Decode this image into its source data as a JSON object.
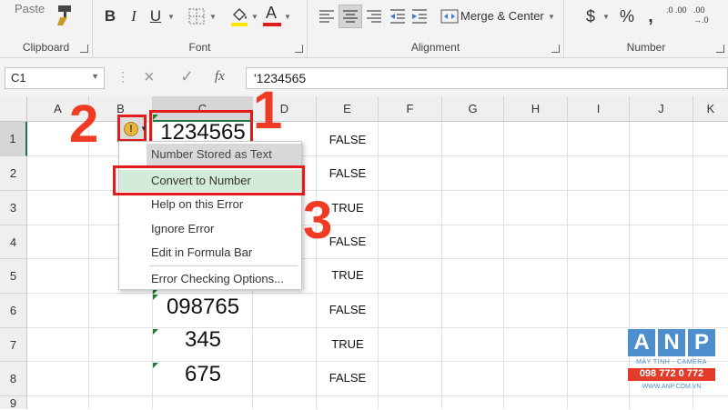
{
  "ribbon": {
    "paste_label": "Paste",
    "groups": {
      "clipboard": "Clipboard",
      "font": "Font",
      "alignment": "Alignment",
      "number": "Number"
    },
    "bold": "B",
    "italic": "I",
    "underline": "U",
    "font_color_letter": "A",
    "merge_center": "Merge & Center",
    "currency": "$",
    "percent": "%",
    "comma": ",",
    "increase_decimal": ".0 .00",
    "decrease_decimal": ".00 →.0",
    "accent_red": "#e21b1b"
  },
  "formula_bar": {
    "name_box": "C1",
    "cancel_icon": "×",
    "enter_icon": "✓",
    "fx_label": "fx",
    "formula_value": "'1234565"
  },
  "columns": [
    "A",
    "B",
    "C",
    "D",
    "E",
    "F",
    "G",
    "H",
    "I",
    "J",
    "K"
  ],
  "rows": [
    "1",
    "2",
    "3",
    "4",
    "5",
    "6",
    "7",
    "8",
    "9"
  ],
  "column_e": [
    "FALSE",
    "FALSE",
    "TRUE",
    "FALSE",
    "TRUE",
    "FALSE",
    "TRUE",
    "FALSE"
  ],
  "column_c": [
    "1234565",
    "",
    "",
    "",
    "",
    "098765",
    "345",
    "675"
  ],
  "error_menu": {
    "header": "Number Stored as Text",
    "items": [
      "Convert to Number",
      "Help on this Error",
      "Ignore Error",
      "Edit in Formula Bar",
      "Error Checking Options..."
    ]
  },
  "annotations": [
    "1",
    "2",
    "3"
  ],
  "watermark": {
    "letters": [
      "A",
      "N",
      "P"
    ],
    "subtitle": "MÁY TÍNH - CAMERA",
    "phone": "098 772 0 772",
    "url": "WWW.ANP.COM.VN"
  }
}
